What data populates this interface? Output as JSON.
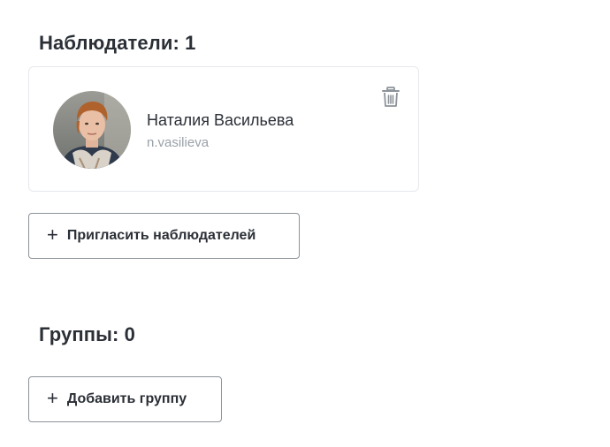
{
  "observers": {
    "title": "Наблюдатели: 1",
    "users": [
      {
        "name": "Наталия Васильева",
        "login": "n.vasilieva"
      }
    ],
    "invite_button": {
      "icon": "+",
      "label": "Пригласить наблюдателей"
    }
  },
  "groups": {
    "title": "Группы: 0",
    "add_button": {
      "icon": "+",
      "label": "Добавить группу"
    }
  }
}
